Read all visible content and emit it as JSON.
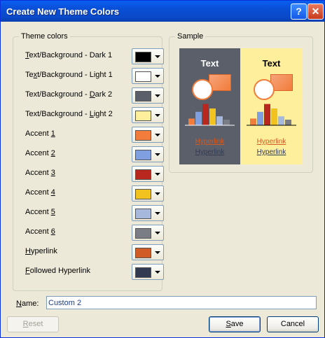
{
  "window": {
    "title": "Create New Theme Colors",
    "help_glyph": "?",
    "close_glyph": "✕"
  },
  "theme_colors": {
    "legend": "Theme colors",
    "items": [
      {
        "pre": "",
        "key": "T",
        "post": "ext/Background - Dark 1",
        "color": "#000000"
      },
      {
        "pre": "Te",
        "key": "x",
        "post": "t/Background - Light 1",
        "color": "#ffffff"
      },
      {
        "pre": "Text/Background - ",
        "key": "D",
        "post": "ark 2",
        "color": "#5a5f6a"
      },
      {
        "pre": "Text/Background - ",
        "key": "L",
        "post": "ight 2",
        "color": "#fdef9c"
      },
      {
        "pre": "Accent ",
        "key": "1",
        "post": "",
        "color": "#f27c3b"
      },
      {
        "pre": "Accent ",
        "key": "2",
        "post": "",
        "color": "#7f9fe0"
      },
      {
        "pre": "Accent ",
        "key": "3",
        "post": "",
        "color": "#b8281f"
      },
      {
        "pre": "Accent ",
        "key": "4",
        "post": "",
        "color": "#f2c31f"
      },
      {
        "pre": "Accent ",
        "key": "5",
        "post": "",
        "color": "#a7b8dd"
      },
      {
        "pre": "Accent ",
        "key": "6",
        "post": "",
        "color": "#7a7d85"
      },
      {
        "pre": "",
        "key": "H",
        "post": "yperlink",
        "color": "#d15b25"
      },
      {
        "pre": "",
        "key": "F",
        "post": "ollowed Hyperlink",
        "color": "#323a52"
      }
    ]
  },
  "sample": {
    "legend": "Sample",
    "left": {
      "bg": "#5a5f6a",
      "text": "Text",
      "text_color": "#ffffff",
      "hyperlink": "Hyperlink",
      "hyperlink_color": "#d15b25",
      "followed": "Hyperlink",
      "followed_color": "#323a52"
    },
    "right": {
      "bg": "#fdef9c",
      "text": "Text",
      "text_color": "#000000",
      "hyperlink": "Hyperlink",
      "hyperlink_color": "#d15b25",
      "followed": "Hyperlink",
      "followed_color": "#323a52"
    },
    "bars": [
      "#f27c3b",
      "#7f9fe0",
      "#b8281f",
      "#f2c31f",
      "#a7b8dd",
      "#7a7d85"
    ],
    "bar_levels": [
      0.3,
      0.6,
      0.95,
      0.75,
      0.4,
      0.25
    ]
  },
  "name_field": {
    "label_pre": "",
    "label_key": "N",
    "label_post": "ame:",
    "value": "Custom 2"
  },
  "buttons": {
    "reset": {
      "pre": "",
      "key": "R",
      "post": "eset"
    },
    "save": {
      "pre": "",
      "key": "S",
      "post": "ave"
    },
    "cancel": "Cancel"
  }
}
